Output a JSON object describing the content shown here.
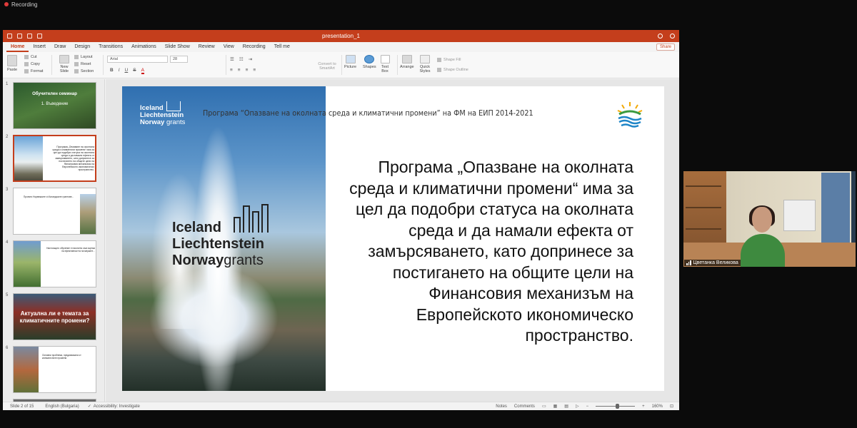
{
  "recording": {
    "label": "Recording"
  },
  "app": {
    "document_title": "presentation_1",
    "tabs": [
      "Home",
      "Insert",
      "Draw",
      "Design",
      "Transitions",
      "Animations",
      "Slide Show",
      "Review",
      "View",
      "Recording",
      "Tell me"
    ],
    "active_tab": "Home",
    "share_label": "Share"
  },
  "ribbon": {
    "paste": "Paste",
    "cut": "Cut",
    "copy": "Copy",
    "format": "Format",
    "new_slide": "New Slide",
    "layout": "Layout",
    "reset": "Reset",
    "section": "Section",
    "font_name": "Arial",
    "font_size": "28",
    "convert_smartart": "Convert to SmartArt",
    "picture": "Picture",
    "shapes": "Shapes",
    "text_box": "Text Box",
    "arrange": "Arrange",
    "quick_styles": "Quick Styles",
    "shape_fill": "Shape Fill",
    "shape_outline": "Shape Outline"
  },
  "thumbnails": [
    {
      "num": "1",
      "title": "Обучителен семинар",
      "sub": "1. Въведение"
    },
    {
      "num": "2",
      "text": "Програма „Опазване на околната среда и климатични промени“ има за цел да подобри статуса на околната среда и да намали ефекта от замърсяването, като допринесе за постигането на общите цели на Финансовия механизъм на Европейското икономическо пространство."
    },
    {
      "num": "3",
      "text": "Проекти Норвежките и Исландските грантове..."
    },
    {
      "num": "4",
      "text": "Настоящото обучение е насочено към оценка на ефективността на мерките..."
    },
    {
      "num": "5",
      "title": "Актуална ли е темата за климатичните промени?"
    },
    {
      "num": "6",
      "text": "Основни проблеми, предизвикани от климатичните промени"
    }
  ],
  "slide": {
    "header": "Програма “Опазване на околната среда и климатични промени” на ФМ на ЕИП 2014-2021",
    "logo_line1": "Iceland",
    "logo_line2": "Liechtenstein",
    "logo_line3_a": "Norway",
    "logo_line3_b": "grants",
    "body": "Програма „Опазване на околната среда и климатични промени“ има за цел да подобри статуса на околната среда и да намали ефекта от замърсяването, като допринесе за постигането на общите цели на Финансовия механизъм на Европейското икономическо пространство."
  },
  "status_bar": {
    "slide_info": "Slide 2 of 15",
    "language": "English (Bulgaria)",
    "accessibility": "Accessibility: Investigate",
    "notes": "Notes",
    "comments": "Comments",
    "zoom": "160%"
  },
  "webcam": {
    "name": "Цветанка Великова"
  },
  "colors": {
    "accent": "#c43e1c"
  }
}
